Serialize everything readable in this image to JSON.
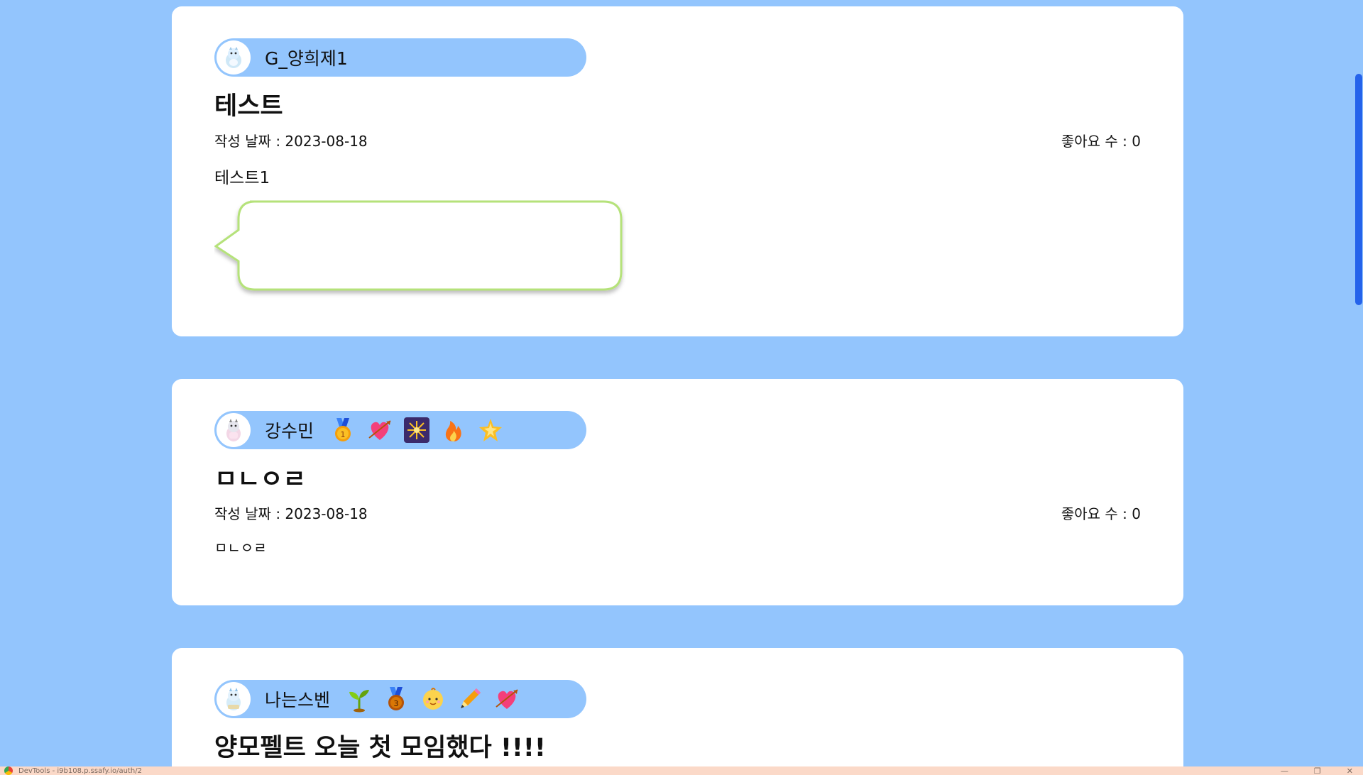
{
  "posts": [
    {
      "author": "G_양희제1",
      "avatar_icon": "dragon-avatar-icon",
      "badges": [],
      "title": "테스트",
      "date_text": "작성 날짜 : 2023-08-18",
      "likes_text": "좋아요 수 : 0",
      "body": "테스트1",
      "has_comment_bubble": true
    },
    {
      "author": "강수민",
      "avatar_icon": "dragon-avatar-icon",
      "badges": [
        "gold-medal-icon",
        "heart-arrow-icon",
        "sparkler-icon",
        "fire-icon",
        "glowing-star-icon"
      ],
      "title": "ㅁㄴㅇㄹ",
      "date_text": "작성 날짜 : 2023-08-18",
      "likes_text": "좋아요 수 : 0",
      "body": "ㅁㄴㅇㄹ"
    },
    {
      "author": "나는스벤",
      "avatar_icon": "dragon-avatar-icon",
      "badges": [
        "seedling-icon",
        "bronze-medal-icon",
        "baby-icon",
        "pencil-icon",
        "heart-arrow-icon"
      ],
      "title": "양모펠트 오늘 첫 모임했다 !!!!"
    }
  ],
  "taskbar": {
    "text": "DevTools - i9b108.p.ssafy.io/auth/2",
    "minimize": "—",
    "restore": "❐",
    "close": "✕"
  },
  "colors": {
    "page_background": "#93c5fd",
    "card_background": "#ffffff",
    "pill_background": "#93c5fd",
    "bubble_border": "#b5e27a",
    "scrollbar_thumb": "#2563eb"
  }
}
